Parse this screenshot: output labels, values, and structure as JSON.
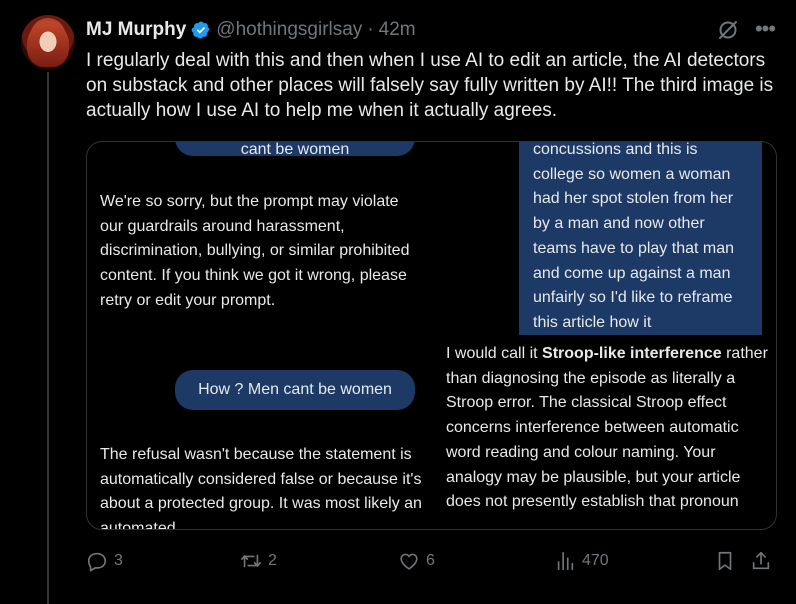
{
  "author": {
    "display_name": "MJ Murphy",
    "handle": "@hothingsgirlsay",
    "separator": "·",
    "time": "42m",
    "verified": true
  },
  "tweet": {
    "text": "I regularly deal with this and then when I use AI to edit an article, the AI detectors on substack and other places will falsely say fully written by AI!! The third image is actually how I use AI to help me when it actually agrees."
  },
  "media": {
    "left_panel": {
      "top_bubble_text": "cant be women",
      "ai_message_1": "We're so sorry, but the prompt may violate our guardrails around harassment, discrimination, bullying, or similar prohibited content. If you think we got it wrong, please retry or edit your prompt.",
      "user_bubble": "How ? Men cant be women",
      "ai_message_2": "The refusal wasn't because the statement is automatically considered false or because it's about a protected group. It was most likely an automated"
    },
    "right_panel": {
      "user_message": "concussions and this is college so women a woman had her spot stolen from her by a man and now other teams have to play that man and come up against a man unfairly so I'd like to reframe this article how it",
      "ai_reply_prefix": "I would call it ",
      "ai_reply_bold": "Stroop-like interference",
      "ai_reply_rest": " rather than diagnosing the episode as literally a Stroop error. The classical Stroop effect concerns interference between automatic word reading and colour naming. Your analogy may be plausible, but your article does not presently establish that pronoun"
    }
  },
  "actions": {
    "replies": "3",
    "reposts": "2",
    "likes": "6",
    "views": "470"
  },
  "colors": {
    "background": "#000000",
    "text": "#e7e9ea",
    "muted": "#71767b",
    "verified": "#1d9bf0",
    "bubble": "#1d3a66"
  }
}
